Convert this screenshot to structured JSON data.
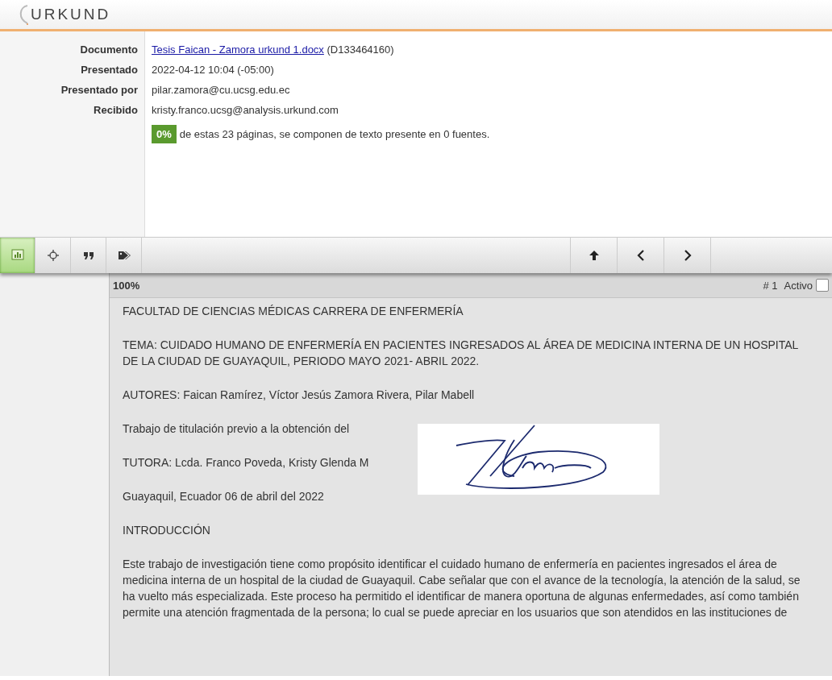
{
  "logo": {
    "text": "URKUND"
  },
  "info": [
    {
      "label": "Documento",
      "kind": "link",
      "value": "Tesis Faican - Zamora urkund 1.docx",
      "extra": "(D133464160)"
    },
    {
      "label": "Presentado",
      "kind": "text",
      "value": "2022-04-12 10:04 (-05:00)"
    },
    {
      "label": "Presentado por",
      "kind": "text",
      "value": "pilar.zamora@cu.ucsg.edu.ec"
    },
    {
      "label": "Recibido",
      "kind": "text",
      "value": "kristy.franco.ucsg@analysis.urkund.com"
    }
  ],
  "summary": {
    "badge": "0%",
    "text": "de estas 23 páginas, se componen de texto presente en 0 fuentes."
  },
  "toolbar": {
    "tools": [
      {
        "kind": "chart",
        "selected": true
      },
      {
        "kind": "target",
        "selected": false
      },
      {
        "kind": "quote",
        "selected": false
      },
      {
        "kind": "tag",
        "selected": false
      }
    ],
    "nav": [
      {
        "kind": "up"
      },
      {
        "kind": "prev"
      },
      {
        "kind": "next"
      }
    ]
  },
  "document": {
    "zoom": "100%",
    "page": "# 1",
    "active_label": "Activo",
    "active": false,
    "paragraphs": [
      "FACULTAD DE CIENCIAS MÉDICAS CARRERA DE ENFERMERÍA",
      "TEMA: CUIDADO HUMANO DE ENFERMERÍA EN PACIENTES INGRESADOS AL ÁREA DE MEDICINA INTERNA DE UN HOSPITAL DE LA CIUDAD DE GUAYAQUIL, PERIODO MAYO 2021- ABRIL 2022.",
      "AUTORES: Faican Ramírez, Víctor Jesús Zamora Rivera, Pilar Mabell",
      "Trabajo de titulación previo a la obtención del",
      "TUTORA: Lcda. Franco Poveda, Kristy Glenda M",
      "Guayaquil, Ecuador 06 de abril del 2022",
      "INTRODUCCIÓN",
      "Este trabajo de investigación tiene como propósito identificar el cuidado humano de enfermería en pacientes ingresados el área de medicina interna de un hospital de la ciudad de Guayaquil. Cabe señalar que con el avance de la tecnología, la atención de la salud, se ha vuelto más especializada. Este proceso ha permitido el identificar de manera oportuna de algunas enfermedades, así como también permite una atención fragmentada de la persona; lo cual se puede apreciar en los usuarios que son atendidos en las instituciones de"
    ]
  }
}
